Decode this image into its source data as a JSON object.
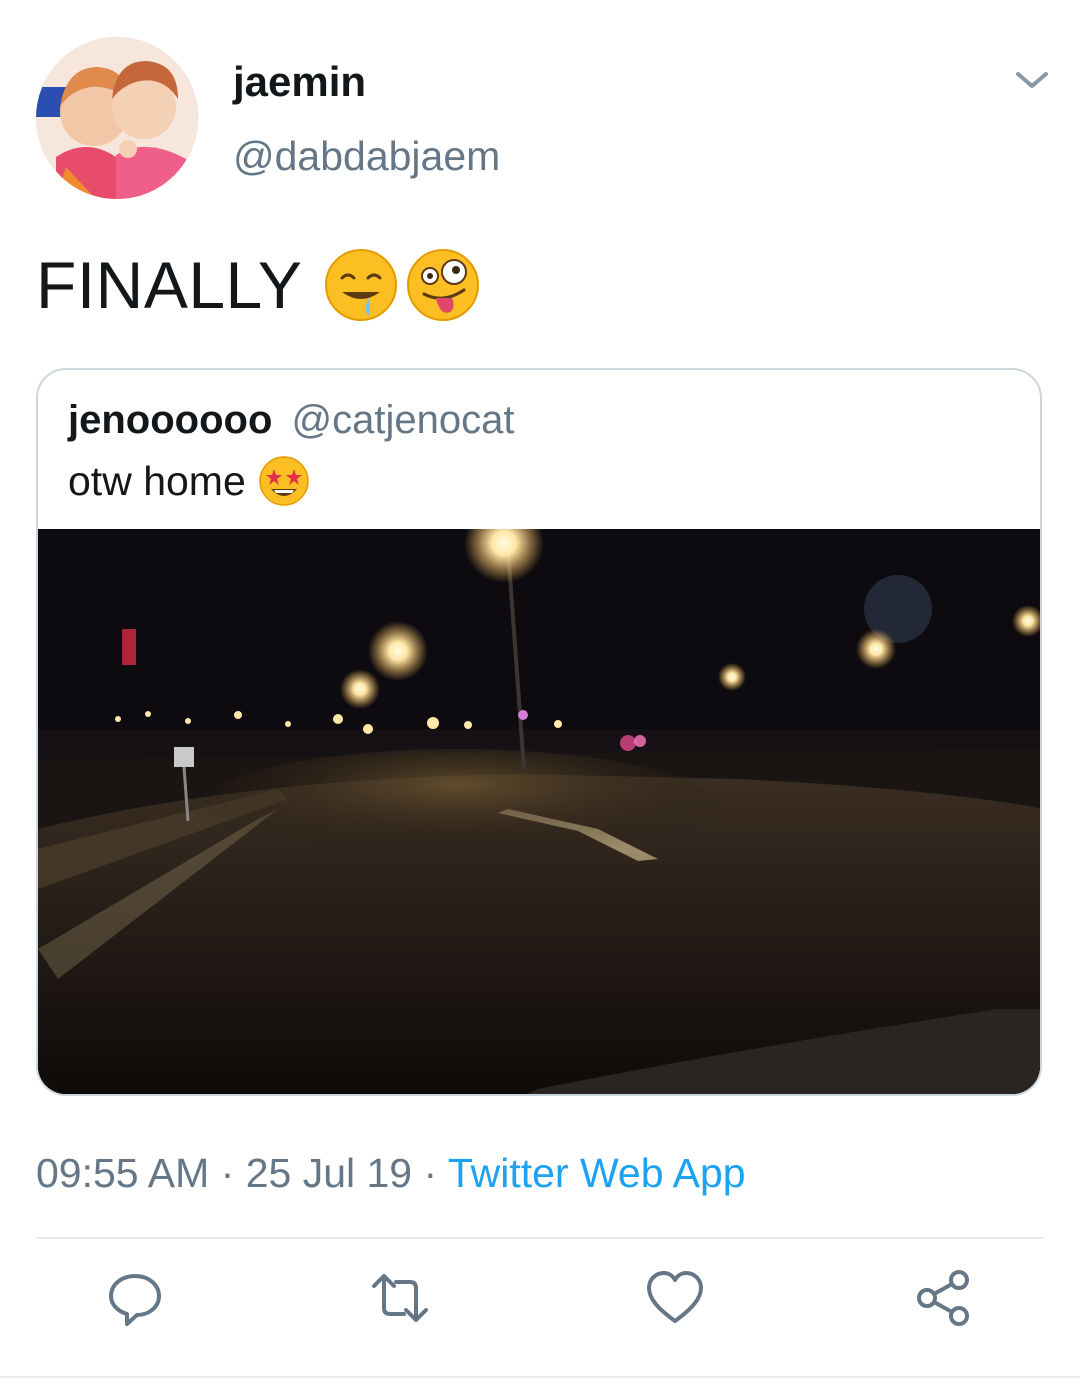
{
  "tweet": {
    "author": {
      "display_name": "jaemin",
      "handle": "@dabdabjaem"
    },
    "text": "FINALLY",
    "emojis": [
      "drooling-face-emoji",
      "zany-face-emoji"
    ],
    "timestamp": "09:55 AM",
    "separator": "·",
    "date": "25 Jul 19",
    "source": "Twitter Web App"
  },
  "quoted_tweet": {
    "display_name": "jenoooooo",
    "handle": "@catjenocat",
    "text": "otw home",
    "emoji": "star-struck-emoji",
    "image": "night-road-photo"
  },
  "actions": [
    "reply-icon",
    "retweet-icon",
    "like-icon",
    "share-icon"
  ],
  "colors": {
    "link": "#1da1f2",
    "secondary_text": "#657786",
    "divider": "#e6ecf0",
    "icon": "#657786"
  }
}
